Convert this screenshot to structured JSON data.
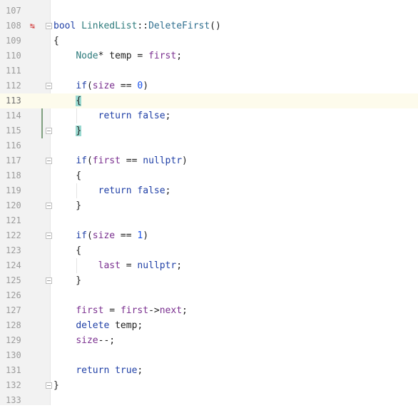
{
  "editor": {
    "lines": [
      {
        "n": "107",
        "tokens": []
      },
      {
        "n": "108",
        "tokens": [
          {
            "t": "bool",
            "c": "kw"
          },
          {
            "t": " "
          },
          {
            "t": "LinkedList",
            "c": "ty"
          },
          {
            "t": "::"
          },
          {
            "t": "DeleteFirst",
            "c": "fn"
          },
          {
            "t": "()"
          }
        ],
        "icon": "↹"
      },
      {
        "n": "109",
        "tokens": [
          {
            "t": "{"
          }
        ]
      },
      {
        "n": "110",
        "tokens": [
          {
            "t": "    "
          },
          {
            "t": "Node",
            "c": "ty"
          },
          {
            "t": "* temp = "
          },
          {
            "t": "first",
            "c": "field"
          },
          {
            "t": ";"
          }
        ]
      },
      {
        "n": "111",
        "tokens": []
      },
      {
        "n": "112",
        "tokens": [
          {
            "t": "    "
          },
          {
            "t": "if",
            "c": "kw"
          },
          {
            "t": "("
          },
          {
            "t": "size",
            "c": "field"
          },
          {
            "t": " == "
          },
          {
            "t": "0",
            "c": "num"
          },
          {
            "t": ")"
          }
        ]
      },
      {
        "n": "113",
        "tokens": [
          {
            "t": "    "
          },
          {
            "t": "{",
            "c": "brace-hl"
          }
        ],
        "current": true
      },
      {
        "n": "114",
        "tokens": [
          {
            "t": "        "
          },
          {
            "t": "return",
            "c": "kw"
          },
          {
            "t": " "
          },
          {
            "t": "false",
            "c": "kw"
          },
          {
            "t": ";"
          }
        ]
      },
      {
        "n": "115",
        "tokens": [
          {
            "t": "    "
          },
          {
            "t": "}",
            "c": "brace-hl"
          }
        ]
      },
      {
        "n": "116",
        "tokens": []
      },
      {
        "n": "117",
        "tokens": [
          {
            "t": "    "
          },
          {
            "t": "if",
            "c": "kw"
          },
          {
            "t": "("
          },
          {
            "t": "first",
            "c": "field"
          },
          {
            "t": " == "
          },
          {
            "t": "nullptr",
            "c": "kw"
          },
          {
            "t": ")"
          }
        ]
      },
      {
        "n": "118",
        "tokens": [
          {
            "t": "    {"
          }
        ]
      },
      {
        "n": "119",
        "tokens": [
          {
            "t": "        "
          },
          {
            "t": "return",
            "c": "kw"
          },
          {
            "t": " "
          },
          {
            "t": "false",
            "c": "kw"
          },
          {
            "t": ";"
          }
        ]
      },
      {
        "n": "120",
        "tokens": [
          {
            "t": "    }"
          }
        ]
      },
      {
        "n": "121",
        "tokens": []
      },
      {
        "n": "122",
        "tokens": [
          {
            "t": "    "
          },
          {
            "t": "if",
            "c": "kw"
          },
          {
            "t": "("
          },
          {
            "t": "size",
            "c": "field"
          },
          {
            "t": " == "
          },
          {
            "t": "1",
            "c": "num"
          },
          {
            "t": ")"
          }
        ]
      },
      {
        "n": "123",
        "tokens": [
          {
            "t": "    {"
          }
        ]
      },
      {
        "n": "124",
        "tokens": [
          {
            "t": "        "
          },
          {
            "t": "last",
            "c": "field"
          },
          {
            "t": " = "
          },
          {
            "t": "nullptr",
            "c": "kw"
          },
          {
            "t": ";"
          }
        ]
      },
      {
        "n": "125",
        "tokens": [
          {
            "t": "    }"
          }
        ]
      },
      {
        "n": "126",
        "tokens": []
      },
      {
        "n": "127",
        "tokens": [
          {
            "t": "    "
          },
          {
            "t": "first",
            "c": "field"
          },
          {
            "t": " = "
          },
          {
            "t": "first",
            "c": "field"
          },
          {
            "t": "->"
          },
          {
            "t": "next",
            "c": "field"
          },
          {
            "t": ";"
          }
        ]
      },
      {
        "n": "128",
        "tokens": [
          {
            "t": "    "
          },
          {
            "t": "delete",
            "c": "kw"
          },
          {
            "t": " temp;"
          }
        ]
      },
      {
        "n": "129",
        "tokens": [
          {
            "t": "    "
          },
          {
            "t": "size",
            "c": "field"
          },
          {
            "t": "--;"
          }
        ]
      },
      {
        "n": "130",
        "tokens": []
      },
      {
        "n": "131",
        "tokens": [
          {
            "t": "    "
          },
          {
            "t": "return",
            "c": "kw"
          },
          {
            "t": " "
          },
          {
            "t": "true",
            "c": "kw"
          },
          {
            "t": ";"
          }
        ]
      },
      {
        "n": "132",
        "tokens": [
          {
            "t": "}"
          }
        ]
      },
      {
        "n": "133",
        "tokens": []
      }
    ]
  }
}
